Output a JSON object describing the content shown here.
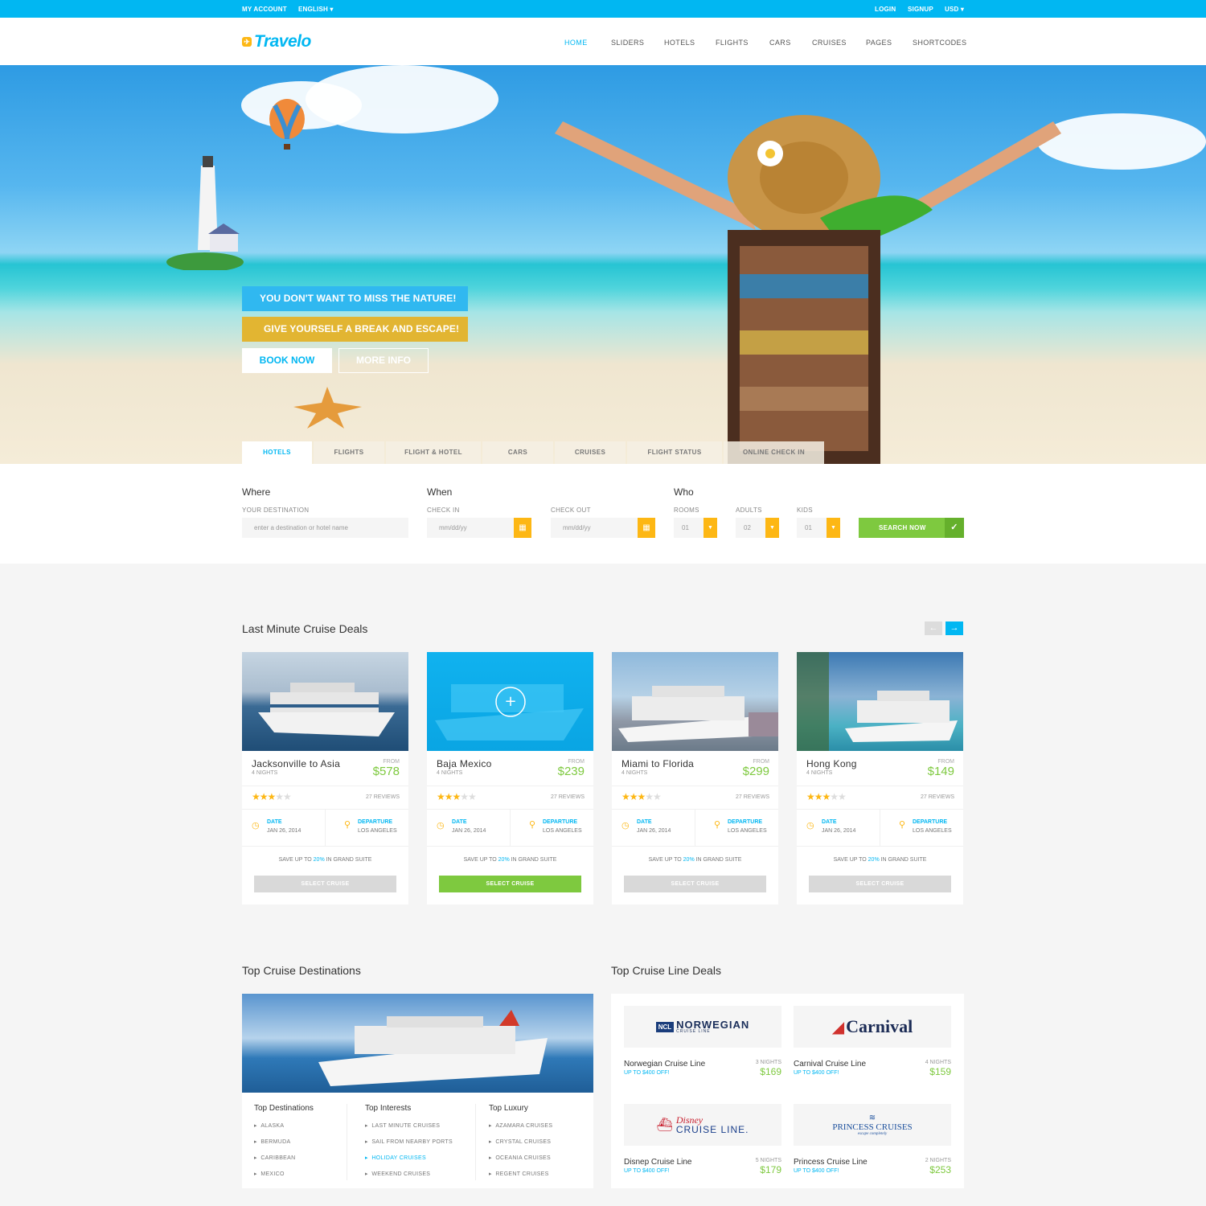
{
  "topbar": {
    "my_account": "MY ACCOUNT",
    "language": "ENGLISH ▾",
    "login": "LOGIN",
    "signup": "SIGNUP",
    "currency": "USD ▾"
  },
  "brand": {
    "name": "Travelo"
  },
  "nav": [
    "HOME",
    "SLIDERS",
    "HOTELS",
    "FLIGHTS",
    "CARS",
    "CRUISES",
    "PAGES",
    "SHORTCODES"
  ],
  "hero": {
    "banner1": "YOU DON'T WANT TO MISS THE NATURE!",
    "banner2": "GIVE YOURSELF A BREAK AND ESCAPE!",
    "book_now": "BOOK NOW",
    "more_info": "MORE INFO"
  },
  "search_tabs": [
    "HOTELS",
    "FLIGHTS",
    "FLIGHT & HOTEL",
    "CARS",
    "CRUISES",
    "FLIGHT STATUS",
    "ONLINE CHECK IN"
  ],
  "search": {
    "where": "Where",
    "when": "When",
    "who": "Who",
    "destination_label": "YOUR DESTINATION",
    "destination_placeholder": "enter a destination or hotel name",
    "checkin_label": "CHECK IN",
    "checkin_placeholder": "mm/dd/yy",
    "checkout_label": "CHECK OUT",
    "checkout_placeholder": "mm/dd/yy",
    "rooms_label": "ROOMS",
    "rooms_value": "01",
    "adults_label": "ADULTS",
    "adults_value": "02",
    "kids_label": "KIDS",
    "kids_value": "01",
    "button": "SEARCH NOW"
  },
  "last_minute": {
    "title": "Last Minute Cruise Deals",
    "cards": [
      {
        "title": "Jacksonville to Asia",
        "nights": "4 NIGHTS",
        "from": "FROM",
        "price": "$578",
        "stars": "★★★",
        "stars_off": "★★",
        "reviews": "27 REVIEWS",
        "date_label": "DATE",
        "date": "JAN 26, 2014",
        "dep_label": "DEPARTURE",
        "dep": "LOS ANGELES",
        "save_pre": "SAVE UP TO ",
        "save_pct": "20%",
        "save_post": " IN GRAND SUITE",
        "button": "SELECT CRUISE",
        "active": false
      },
      {
        "title": "Baja Mexico",
        "nights": "4 NIGHTS",
        "from": "FROM",
        "price": "$239",
        "stars": "★★★",
        "stars_off": "★★",
        "reviews": "27 REVIEWS",
        "date_label": "DATE",
        "date": "JAN 26, 2014",
        "dep_label": "DEPARTURE",
        "dep": "LOS ANGELES",
        "save_pre": "SAVE UP TO ",
        "save_pct": "20%",
        "save_post": " IN GRAND SUITE",
        "button": "SELECT CRUISE",
        "active": true
      },
      {
        "title": "Miami to Florida",
        "nights": "4 NIGHTS",
        "from": "FROM",
        "price": "$299",
        "stars": "★★★",
        "stars_off": "★★",
        "reviews": "27 REVIEWS",
        "date_label": "DATE",
        "date": "JAN 26, 2014",
        "dep_label": "DEPARTURE",
        "dep": "LOS ANGELES",
        "save_pre": "SAVE UP TO ",
        "save_pct": "20%",
        "save_post": " IN GRAND SUITE",
        "button": "SELECT CRUISE",
        "active": false
      },
      {
        "title": "Hong Kong",
        "nights": "4 NIGHTS",
        "from": "FROM",
        "price": "$149",
        "stars": "★★★",
        "stars_off": "★★",
        "reviews": "27 REVIEWS",
        "date_label": "DATE",
        "date": "JAN 26, 2014",
        "dep_label": "DEPARTURE",
        "dep": "LOS ANGELES",
        "save_pre": "SAVE UP TO ",
        "save_pct": "20%",
        "save_post": " IN GRAND SUITE",
        "button": "SELECT CRUISE",
        "active": false
      }
    ]
  },
  "top_destinations": {
    "title": "Top Cruise Destinations",
    "columns": [
      {
        "heading": "Top Destinations",
        "items": [
          "ALASKA",
          "BERMUDA",
          "CARIBBEAN",
          "MEXICO"
        ]
      },
      {
        "heading": "Top Interests",
        "items": [
          "LAST MINUTE CRUISES",
          "SAIL FROM NEARBY PORTS",
          "HOLIDAY CRUISES",
          "WEEKEND CRUISES"
        ]
      },
      {
        "heading": "Top Luxury",
        "items": [
          "AZAMARA CRUISES",
          "CRYSTAL CRUISES",
          "OCEANIA CRUISES",
          "REGENT CRUISES"
        ]
      }
    ]
  },
  "cruise_line_deals": {
    "title": "Top Cruise Line Deals",
    "deals": [
      {
        "logo_main": "NORWEGIAN",
        "logo_badge": "NCL",
        "logo_sub": "CRUISE LINE",
        "name": "Norwegian Cruise Line",
        "offer": "UP TO $400 OFF!",
        "nights": "3 NIGHTS",
        "price": "$169"
      },
      {
        "logo_main": "Carnival",
        "name": "Carnival Cruise Line",
        "offer": "UP TO $400 OFF!",
        "nights": "4 NIGHTS",
        "price": "$159"
      },
      {
        "logo_main": "Disney",
        "logo_sub": "CRUISE LINE.",
        "name": "Disnep Cruise Line",
        "offer": "UP TO $400 OFF!",
        "nights": "5 NIGHTS",
        "price": "$179"
      },
      {
        "logo_main": "PRINCESS CRUISES",
        "logo_sub": "escape completely",
        "name": "Princess Cruise Line",
        "offer": "UP TO $400 OFF!",
        "nights": "2 NIGHTS",
        "price": "$253"
      }
    ]
  },
  "colors": {
    "brand": "#01b7f2",
    "accent": "#fdb714",
    "green": "#7ec93f"
  }
}
